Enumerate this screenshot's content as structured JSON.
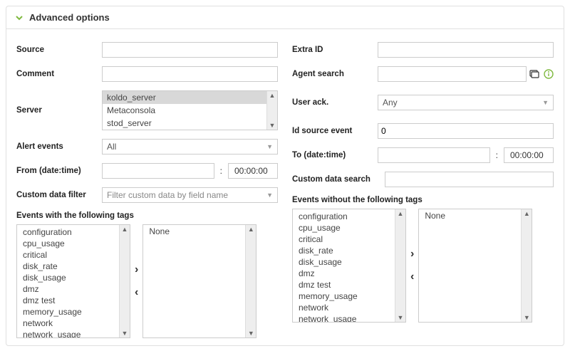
{
  "header": {
    "title": "Advanced options"
  },
  "left": {
    "source": {
      "label": "Source",
      "value": ""
    },
    "comment": {
      "label": "Comment",
      "value": ""
    },
    "server": {
      "label": "Server",
      "options": [
        "koldo_server",
        "Metaconsola",
        "stod_server"
      ],
      "selected": "koldo_server"
    },
    "alert_events": {
      "label": "Alert events",
      "value": "All"
    },
    "from": {
      "label": "From (date:time)",
      "date": "",
      "time": "00:00:00"
    },
    "custom_filter": {
      "label": "Custom data filter",
      "placeholder": "Filter custom data by field name"
    },
    "tags_label": "Events with the following tags",
    "tags": [
      "configuration",
      "cpu_usage",
      "critical",
      "disk_rate",
      "disk_usage",
      "dmz",
      "dmz test",
      "memory_usage",
      "network",
      "network_usage"
    ],
    "selected_tags_none": "None"
  },
  "right": {
    "extra_id": {
      "label": "Extra ID",
      "value": ""
    },
    "agent_search": {
      "label": "Agent search",
      "value": ""
    },
    "user_ack": {
      "label": "User ack.",
      "value": "Any"
    },
    "id_source_event": {
      "label": "Id source event",
      "value": "0"
    },
    "to": {
      "label": "To (date:time)",
      "date": "",
      "time": "00:00:00"
    },
    "custom_search": {
      "label": "Custom data search",
      "value": ""
    },
    "tags_label": "Events without the following tags",
    "tags": [
      "configuration",
      "cpu_usage",
      "critical",
      "disk_rate",
      "disk_usage",
      "dmz",
      "dmz test",
      "memory_usage",
      "network",
      "network_usage"
    ],
    "selected_tags_none": "None"
  }
}
